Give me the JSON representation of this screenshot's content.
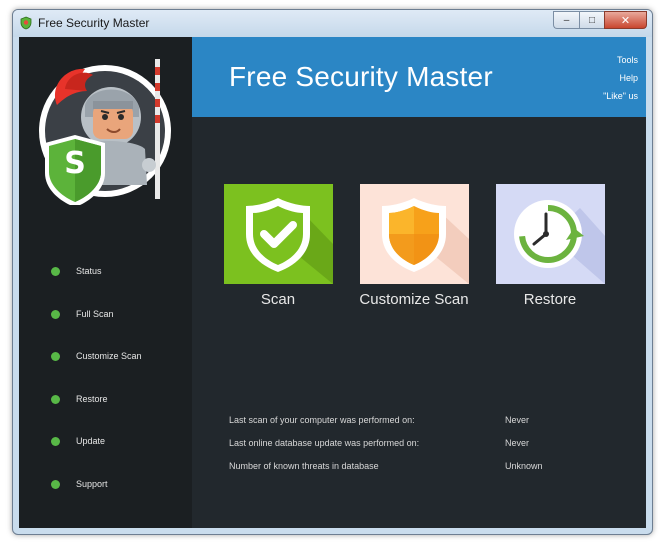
{
  "window": {
    "title": "Free Security Master",
    "minimize_symbol": "–",
    "maximize_symbol": "□",
    "close_symbol": "✕"
  },
  "header": {
    "title": "Free Security Master",
    "links": [
      "Tools",
      "Help",
      "\"Like\" us"
    ]
  },
  "mascot": {
    "badge_letter": "S"
  },
  "sidebar": {
    "items": [
      {
        "label": "Status"
      },
      {
        "label": "Full Scan"
      },
      {
        "label": "Customize Scan"
      },
      {
        "label": "Restore"
      },
      {
        "label": "Update"
      },
      {
        "label": "Support"
      }
    ]
  },
  "tiles": [
    {
      "label": "Scan",
      "icon": "shield-check-icon",
      "bg": "#7cc11f"
    },
    {
      "label": "Customize Scan",
      "icon": "shield-orange-icon",
      "bg": "#fde3d8"
    },
    {
      "label": "Restore",
      "icon": "clock-restore-icon",
      "bg": "#d5daf5"
    }
  ],
  "info": [
    {
      "label": "Last scan of your computer was performed on:",
      "value": "Never"
    },
    {
      "label": "Last online database update was performed on:",
      "value": "Never"
    },
    {
      "label": "Number of known threats in database",
      "value": "Unknown"
    }
  ],
  "colors": {
    "header": "#2b86c5",
    "sidebar": "#1b1f22",
    "main": "#22282d",
    "accent_green": "#58b847"
  }
}
